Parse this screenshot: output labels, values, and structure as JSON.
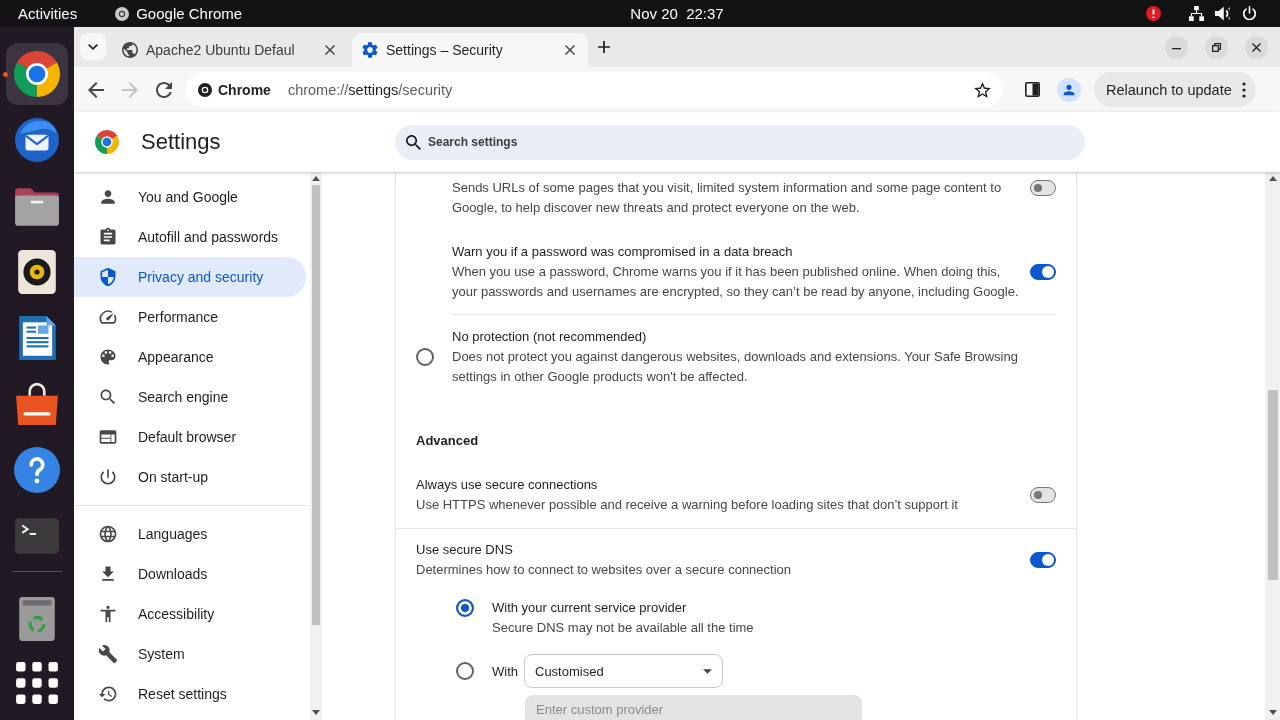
{
  "top_bar": {
    "activities": "Activities",
    "app_menu": "Google Chrome",
    "clock": "Nov 20  22:37"
  },
  "dock": {
    "launchers": [
      {
        "kind": "browser",
        "active": true
      },
      {
        "kind": "mail",
        "active": false
      },
      {
        "kind": "files",
        "active": false
      },
      {
        "kind": "music",
        "active": false
      },
      {
        "kind": "writer",
        "active": false
      },
      {
        "kind": "software",
        "active": false
      },
      {
        "kind": "help",
        "active": false
      },
      {
        "kind": "terminal",
        "active": false
      }
    ],
    "bottom": [
      {
        "kind": "trash",
        "active": false
      },
      {
        "kind": "apps",
        "active": false
      }
    ]
  },
  "tabs": [
    {
      "kind": "web",
      "title": "Apache2 Ubuntu Defaul",
      "selected": false
    },
    {
      "kind": "settings",
      "title": "Settings – Security",
      "selected": true
    }
  ],
  "toolbar": {
    "nav": [
      {
        "kind": "back",
        "disabled": false
      },
      {
        "kind": "forward",
        "disabled": true
      },
      {
        "kind": "reload",
        "disabled": false
      }
    ],
    "site_chip": "Chrome",
    "url": {
      "scheme": "chrome://",
      "host": "settings",
      "path": "/security"
    },
    "relaunch": "Relaunch to update"
  },
  "settings_header": {
    "title": "Settings",
    "search_placeholder": "Search settings"
  },
  "sidebar": {
    "sections": [
      {
        "items": [
          {
            "kind": "person",
            "label": "You and Google",
            "selected": false
          },
          {
            "kind": "clipboard",
            "label": "Autofill and passwords",
            "selected": false
          },
          {
            "kind": "shield",
            "label": "Privacy and security",
            "selected": true
          },
          {
            "kind": "gauge",
            "label": "Performance",
            "selected": false
          },
          {
            "kind": "palette",
            "label": "Appearance",
            "selected": false
          },
          {
            "kind": "search",
            "label": "Search engine",
            "selected": false
          },
          {
            "kind": "browser-window",
            "label": "Default browser",
            "selected": false
          },
          {
            "kind": "power",
            "label": "On start-up",
            "selected": false
          }
        ]
      },
      {
        "items": [
          {
            "kind": "globe",
            "label": "Languages",
            "selected": false
          },
          {
            "kind": "download",
            "label": "Downloads",
            "selected": false
          },
          {
            "kind": "accessibility",
            "label": "Accessibility",
            "selected": false
          },
          {
            "kind": "wrench",
            "label": "System",
            "selected": false
          },
          {
            "kind": "history",
            "label": "Reset settings",
            "selected": false
          }
        ]
      }
    ]
  },
  "safe_browsing": {
    "sub_settings": [
      {
        "lines": [
          "Sends URLs of some pages that you visit, limited system information and some page content to",
          "Google, to help discover new threats and protect everyone on the web."
        ],
        "on": false
      },
      {
        "title": "Warn you if a password was compromised in a data breach",
        "lines": [
          "When you use a password, Chrome warns you if it has been published online. When doing this,",
          "your passwords and usernames are encrypted, so they can’t be read by anyone, including Google."
        ],
        "on": true
      }
    ],
    "options": [
      {
        "title": "No protection (not recommended)",
        "lines": [
          "Does not protect you against dangerous websites, downloads and extensions. Your Safe Browsing",
          "settings in other Google products won't be affected."
        ],
        "selected": false
      }
    ]
  },
  "advanced": {
    "heading": "Advanced",
    "settings": [
      {
        "title": "Always use secure connections",
        "lines": [
          "Use HTTPS whenever possible and receive a warning before loading sites that don’t support it"
        ],
        "on": false
      },
      {
        "title": "Use secure DNS",
        "lines": [
          "Determines how to connect to websites over a secure connection"
        ],
        "on": true
      }
    ],
    "dns_options": [
      {
        "kind": "automatic",
        "title": "With your current service provider",
        "lines": [
          "Secure DNS may not be available all the time"
        ],
        "selected": true
      },
      {
        "kind": "custom",
        "label": "With",
        "provider": "Customised",
        "custom_input": {
          "placeholder": "Enter custom provider",
          "disabled": true
        },
        "selected": false
      }
    ]
  }
}
